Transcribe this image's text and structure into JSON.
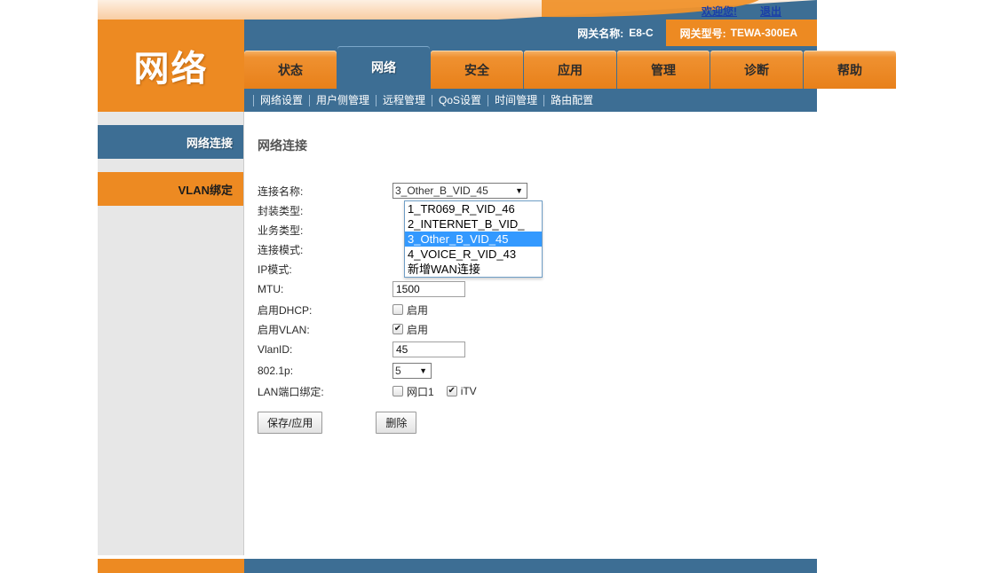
{
  "topbar": {
    "welcome": "欢迎您!",
    "logout": "退出"
  },
  "header": {
    "logo_text": "网络",
    "gateway_name_label": "网关名称:",
    "gateway_name_value": "E8-C",
    "gateway_model_label": "网关型号:",
    "gateway_model_value": "TEWA-300EA"
  },
  "tabs": [
    {
      "label": "状态",
      "active": false
    },
    {
      "label": "网络",
      "active": true
    },
    {
      "label": "安全",
      "active": false
    },
    {
      "label": "应用",
      "active": false
    },
    {
      "label": "管理",
      "active": false
    },
    {
      "label": "诊断",
      "active": false
    },
    {
      "label": "帮助",
      "active": false
    }
  ],
  "subnav": [
    {
      "label": "网络设置"
    },
    {
      "label": "用户侧管理"
    },
    {
      "label": "远程管理"
    },
    {
      "label": "QoS设置"
    },
    {
      "label": "时间管理"
    },
    {
      "label": "路由配置"
    }
  ],
  "sidebar": {
    "items": [
      {
        "label": "网络连接",
        "state": "active"
      },
      {
        "label": "VLAN绑定",
        "state": "orange"
      }
    ]
  },
  "content": {
    "title": "网络连接",
    "form": {
      "connection_name_label": "连接名称:",
      "connection_name_value": "3_Other_B_VID_45",
      "encapsulation_label": "封装类型:",
      "service_type_label": "业务类型:",
      "connection_mode_label": "连接模式:",
      "ip_mode_label": "IP模式:",
      "mtu_label": "MTU:",
      "mtu_value": "1500",
      "enable_dhcp_label": "启用DHCP:",
      "enable_dhcp_checkbox_label": "启用",
      "enable_dhcp_checked": false,
      "enable_vlan_label": "启用VLAN:",
      "enable_vlan_checkbox_label": "启用",
      "enable_vlan_checked": true,
      "vlan_id_label": "VlanID:",
      "vlan_id_value": "45",
      "dot1p_label": "802.1p:",
      "dot1p_value": "5",
      "lan_binding_label": "LAN端口绑定:",
      "lan_ports": [
        {
          "label": "网口1",
          "checked": false
        },
        {
          "label": "iTV",
          "checked": true
        }
      ]
    },
    "dropdown_options": [
      {
        "label": "1_TR069_R_VID_46",
        "selected": false
      },
      {
        "label": "2_INTERNET_B_VID_",
        "selected": false
      },
      {
        "label": "3_Other_B_VID_45",
        "selected": true
      },
      {
        "label": "4_VOICE_R_VID_43",
        "selected": false
      },
      {
        "label": "新增WAN连接",
        "selected": false
      }
    ],
    "buttons": {
      "save": "保存/应用",
      "delete": "删除"
    }
  },
  "icons": {
    "caret_down": "▼"
  },
  "colors": {
    "orange": "#ed8a22",
    "blue": "#3d6e94",
    "select_highlight": "#3399ff",
    "sidebar_bg": "#e7e7e7"
  }
}
